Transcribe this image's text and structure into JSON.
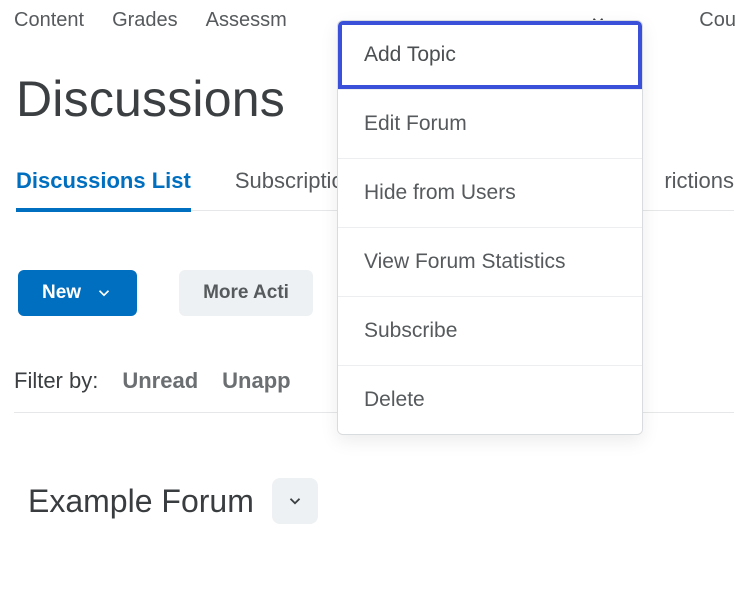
{
  "topnav": {
    "items": [
      "Content",
      "Grades",
      "Assessm",
      "Cou"
    ],
    "trail_fragment": "rictions"
  },
  "page": {
    "title": "Discussions"
  },
  "subtabs": {
    "active": "Discussions List",
    "second": "Subscriptio"
  },
  "actions": {
    "new_label": "New",
    "more_label": "More Acti"
  },
  "filters": {
    "label": "Filter by:",
    "unread": "Unread",
    "unapproved": "Unapp"
  },
  "forum": {
    "name": "Example Forum"
  },
  "dropdown": {
    "items": [
      "Add Topic",
      "Edit Forum",
      "Hide from Users",
      "View Forum Statistics",
      "Subscribe",
      "Delete"
    ],
    "selected_index": 0
  }
}
